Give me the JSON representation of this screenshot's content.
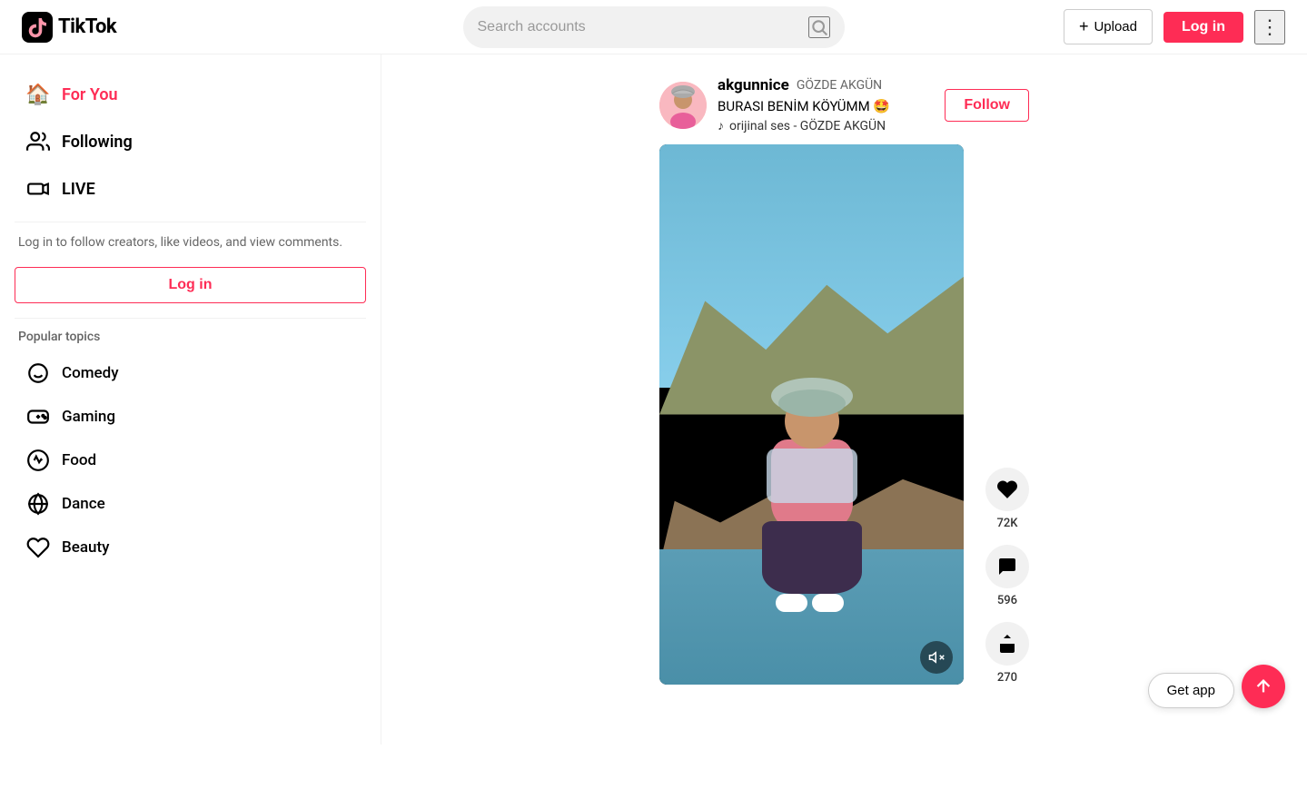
{
  "header": {
    "logo_text": "TikTok",
    "search_placeholder": "Search accounts",
    "upload_label": "Upload",
    "login_label": "Log in"
  },
  "sidebar": {
    "nav_items": [
      {
        "id": "for-you",
        "label": "For You",
        "active": true,
        "icon": "🏠"
      },
      {
        "id": "following",
        "label": "Following",
        "active": false,
        "icon": "👥"
      },
      {
        "id": "live",
        "label": "LIVE",
        "active": false,
        "icon": "📹"
      }
    ],
    "login_prompt": "Log in to follow creators, like videos, and view comments.",
    "login_button": "Log in",
    "popular_topics_title": "Popular topics",
    "topics": [
      {
        "id": "comedy",
        "label": "Comedy",
        "icon": "😊"
      },
      {
        "id": "gaming",
        "label": "Gaming",
        "icon": "🎮"
      },
      {
        "id": "food",
        "label": "Food",
        "icon": "🍕"
      },
      {
        "id": "dance",
        "label": "Dance",
        "icon": "🌐"
      },
      {
        "id": "beauty",
        "label": "Beauty",
        "icon": "💅"
      }
    ]
  },
  "video": {
    "username": "akgunnice",
    "display_name": "GÖZDE AKGÜN",
    "caption": "BURASI BENİM KÖYÜMM 🤩",
    "sound": "orijinal ses - GÖZDE AKGÜN",
    "follow_label": "Follow",
    "likes_count": "72K",
    "comments_count": "596",
    "shares_count": "270",
    "mute_icon": "🔇"
  },
  "footer": {
    "get_app_label": "Get app"
  },
  "icons": {
    "search": "🔍",
    "plus": "+",
    "more": "⋮",
    "heart": "♥",
    "comment": "💬",
    "share": "➤",
    "music_note": "♪",
    "arrow_up": "↑"
  }
}
